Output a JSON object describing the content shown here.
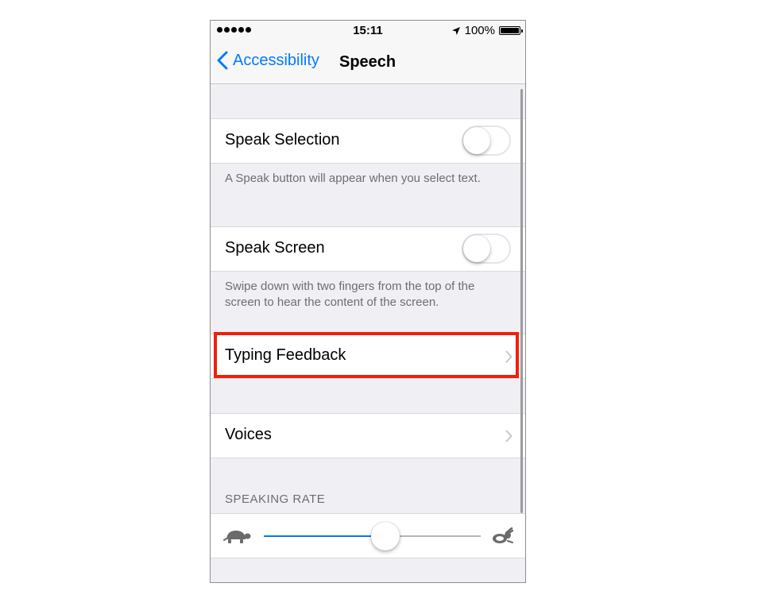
{
  "status_bar": {
    "time": "15:11",
    "battery_text": "100%",
    "icons": [
      "signal-dots-icon",
      "location-arrow-icon",
      "battery-icon"
    ]
  },
  "nav": {
    "back_label": "Accessibility",
    "title": "Speech",
    "back_icon": "chevron-left-icon"
  },
  "settings": {
    "speak_selection": {
      "label": "Speak Selection",
      "enabled": false,
      "footnote": "A Speak button will appear when you select text."
    },
    "speak_screen": {
      "label": "Speak Screen",
      "enabled": false,
      "footnote": "Swipe down with two fingers from the top of the screen to hear the content of the screen."
    },
    "typing_feedback": {
      "label": "Typing Feedback"
    },
    "voices": {
      "label": "Voices"
    },
    "speaking_rate": {
      "header": "SPEAKING RATE",
      "value_fraction": 0.56,
      "slow_icon": "turtle-icon",
      "fast_icon": "hare-icon"
    }
  },
  "colors": {
    "accent": "#007aff",
    "highlight": "#f01f0c",
    "group_background": "#efeff4"
  }
}
